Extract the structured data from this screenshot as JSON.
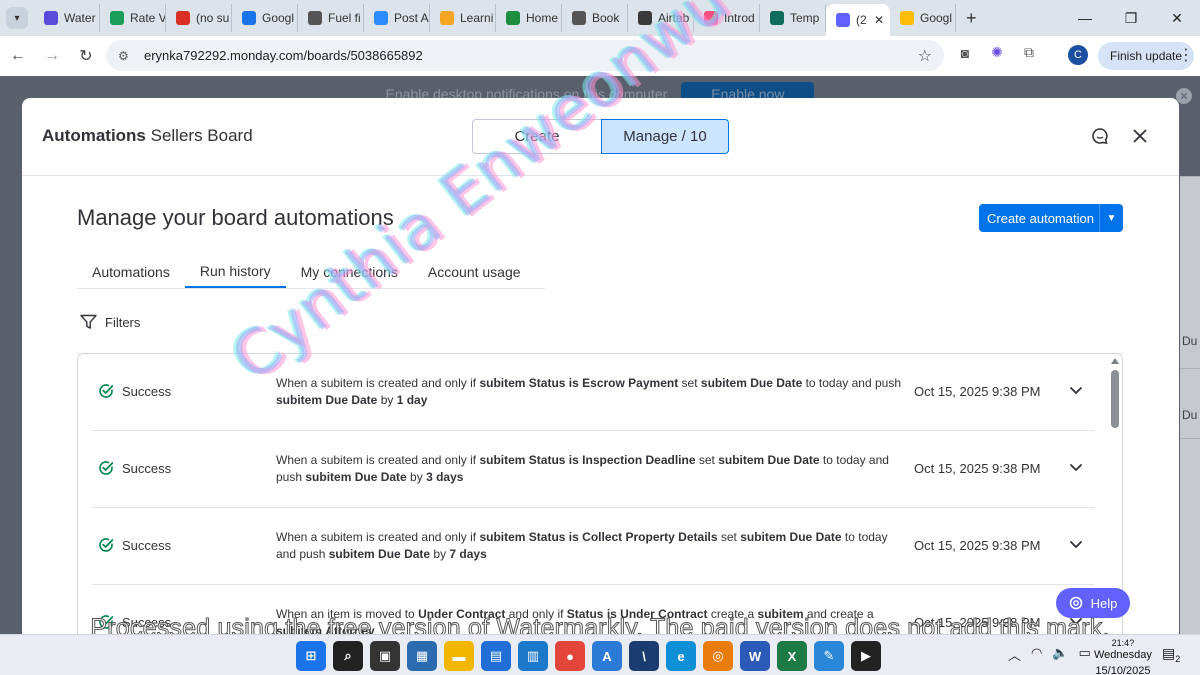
{
  "browser": {
    "tabs": [
      {
        "label": "Water",
        "icon": "shield-icon",
        "color": "#5b4bdb"
      },
      {
        "label": "Rate V",
        "icon": "star-icon",
        "color": "#1a9e5a"
      },
      {
        "label": "(no su",
        "icon": "gmail-icon",
        "color": "#d93025"
      },
      {
        "label": "Googl",
        "icon": "calendar-icon",
        "color": "#1a73e8"
      },
      {
        "label": "Fuel fi",
        "icon": "globe-icon",
        "color": "#555555"
      },
      {
        "label": "Post A",
        "icon": "zoom-icon",
        "color": "#2d8cff"
      },
      {
        "label": "Learni",
        "icon": "learn-icon",
        "color": "#f5a623"
      },
      {
        "label": "Home",
        "icon": "drive-icon",
        "color": "#1e8e3e"
      },
      {
        "label": "Book",
        "icon": "globe-icon",
        "color": "#555555"
      },
      {
        "label": "Airtab",
        "icon": "airtable-icon",
        "color": "#3a3a3a"
      },
      {
        "label": "Introd",
        "icon": "loom-icon",
        "color": "#ff4f81"
      },
      {
        "label": "Temp",
        "icon": "gs-icon",
        "color": "#0f6b5c"
      },
      {
        "label": "(2",
        "icon": "monday-icon",
        "color": "#6161ff"
      },
      {
        "label": "Googl",
        "icon": "slides-icon",
        "color": "#fbbc04"
      }
    ],
    "active_tab_index": 12,
    "url": "erynka792292.monday.com/boards/5038665892",
    "finish_update": "Finish update",
    "profile_initial": "C"
  },
  "notification_bar": {
    "text": "Enable desktop notifications on this computer",
    "button": "Enable now"
  },
  "background_board": {
    "cells": [
      "Du",
      "Du"
    ]
  },
  "modal": {
    "title_bold": "Automations",
    "title_rest": " Sellers Board",
    "segments": {
      "create": "Create",
      "manage": "Manage / 10"
    },
    "heading": "Manage your board automations",
    "create_button": "Create automation",
    "tabs": [
      "Automations",
      "Run history",
      "My connections",
      "Account usage"
    ],
    "active_tab": "Run history",
    "filters_label": "Filters",
    "runs": [
      {
        "status": "Success",
        "parts": [
          {
            "t": "When a subitem is created and only if ",
            "b": false
          },
          {
            "t": "subitem Status",
            "b": true
          },
          {
            "t": " ",
            "b": false
          },
          {
            "t": "is",
            "b": true
          },
          {
            "t": " ",
            "b": false
          },
          {
            "t": "Escrow Payment",
            "b": true
          },
          {
            "t": " set ",
            "b": false
          },
          {
            "t": "subitem Due Date",
            "b": true
          },
          {
            "t": " to today and push ",
            "b": false
          },
          {
            "t": "subitem Due Date",
            "b": true
          },
          {
            "t": " by ",
            "b": false
          },
          {
            "t": "1 day",
            "b": true
          }
        ],
        "date": "Oct 15, 2025 9:38 PM"
      },
      {
        "status": "Success",
        "parts": [
          {
            "t": "When a subitem is created and only if ",
            "b": false
          },
          {
            "t": "subitem Status",
            "b": true
          },
          {
            "t": " ",
            "b": false
          },
          {
            "t": "is",
            "b": true
          },
          {
            "t": " ",
            "b": false
          },
          {
            "t": "Inspection Deadline",
            "b": true
          },
          {
            "t": " set ",
            "b": false
          },
          {
            "t": "subitem Due Date",
            "b": true
          },
          {
            "t": " to today and push ",
            "b": false
          },
          {
            "t": "subitem Due Date",
            "b": true
          },
          {
            "t": " by ",
            "b": false
          },
          {
            "t": "3 days",
            "b": true
          }
        ],
        "date": "Oct 15, 2025 9:38 PM"
      },
      {
        "status": "Success",
        "parts": [
          {
            "t": "When a subitem is created and only if ",
            "b": false
          },
          {
            "t": "subitem Status",
            "b": true
          },
          {
            "t": " ",
            "b": false
          },
          {
            "t": "is",
            "b": true
          },
          {
            "t": " ",
            "b": false
          },
          {
            "t": "Collect Property Details",
            "b": true
          },
          {
            "t": " set ",
            "b": false
          },
          {
            "t": "subitem Due Date",
            "b": true
          },
          {
            "t": " to today and push ",
            "b": false
          },
          {
            "t": "subitem Due Date",
            "b": true
          },
          {
            "t": " by ",
            "b": false
          },
          {
            "t": "7 days",
            "b": true
          }
        ],
        "date": "Oct 15, 2025 9:38 PM"
      },
      {
        "status": "Success",
        "parts": [
          {
            "t": "When an item is moved to ",
            "b": false
          },
          {
            "t": "Under Contract",
            "b": true
          },
          {
            "t": " and only if ",
            "b": false
          },
          {
            "t": "Status",
            "b": true
          },
          {
            "t": " ",
            "b": false
          },
          {
            "t": "is",
            "b": true
          },
          {
            "t": " ",
            "b": false
          },
          {
            "t": "Under Contract",
            "b": true
          },
          {
            "t": " create a ",
            "b": false
          },
          {
            "t": "subitem",
            "b": true
          },
          {
            "t": " and create a ",
            "b": false
          },
          {
            "t": "subitem",
            "b": true
          },
          {
            "t": " ",
            "b": false
          },
          {
            "t": "Attorney",
            "b": true
          }
        ],
        "date": "Oct 15, 2025 9:38 PM"
      }
    ],
    "scroll_position": 0.0
  },
  "help_button": "Help",
  "watermarks": {
    "diagonal": "Cynthia Enweonwu-Arinze",
    "bottom": "Processed using the free version of Watermarkly. The paid version does not add this mark."
  },
  "taskbar": {
    "apps": [
      {
        "icon": "windows-icon",
        "color": "#1a73e8",
        "glyph": "⊞"
      },
      {
        "icon": "search-icon",
        "color": "#222222",
        "glyph": "⌕"
      },
      {
        "icon": "task-view-icon",
        "color": "#333333",
        "glyph": "▣"
      },
      {
        "icon": "widgets-icon",
        "color": "#2b6cb0",
        "glyph": "▦"
      },
      {
        "icon": "file-explorer-icon",
        "color": "#f2b600",
        "glyph": "▬"
      },
      {
        "icon": "store-icon",
        "color": "#1f6fd6",
        "glyph": "▤"
      },
      {
        "icon": "chart-app-icon",
        "color": "#1c78c8",
        "glyph": "▥"
      },
      {
        "icon": "chrome-icon",
        "color": "#e3453a",
        "glyph": "●"
      },
      {
        "icon": "vpn-icon",
        "color": "#2a7ad6",
        "glyph": "A"
      },
      {
        "icon": "terminal-icon",
        "color": "#1a3c6e",
        "glyph": "\\"
      },
      {
        "icon": "edge-icon",
        "color": "#0f8fd6",
        "glyph": "e"
      },
      {
        "icon": "blender-icon",
        "color": "#e87d0d",
        "glyph": "◎"
      },
      {
        "icon": "word-icon",
        "color": "#2b5ab8",
        "glyph": "W"
      },
      {
        "icon": "excel-icon",
        "color": "#1e7a44",
        "glyph": "X"
      },
      {
        "icon": "paint-icon",
        "color": "#2a86d6",
        "glyph": "✎"
      },
      {
        "icon": "media-player-icon",
        "color": "#222222",
        "glyph": "▶"
      }
    ],
    "time_partial": "21:4?",
    "day": "Wednesday",
    "date": "15/10/2025",
    "notifications_count": "2"
  }
}
